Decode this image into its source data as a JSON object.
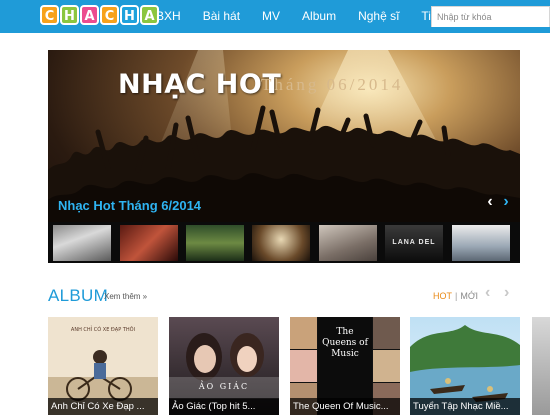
{
  "logo": {
    "letters": [
      "C",
      "H",
      "A",
      "C",
      "H",
      "A"
    ],
    "colors": [
      "#f7a21b",
      "#8cc63f",
      "#ec4d8f",
      "#f7a21b",
      "#1fa2dc",
      "#8cc63f"
    ]
  },
  "nav": {
    "items": [
      "BXH",
      "Bài hát",
      "MV",
      "Album",
      "Nghệ sĩ",
      "Tin tức"
    ]
  },
  "search": {
    "placeholder": "Nhập từ khóa",
    "value": ""
  },
  "hero": {
    "title": "NHẠC HOT",
    "subtitle": "Tháng 06/2014",
    "caption": "Nhạc Hot Tháng 6/2014",
    "prev_icon": "chevron-left-icon",
    "next_icon": "chevron-right-icon",
    "thumbnails": [
      {
        "name": "thumb-portrait-1"
      },
      {
        "name": "thumb-portrait-2"
      },
      {
        "name": "thumb-landscape"
      },
      {
        "name": "thumb-concert"
      },
      {
        "name": "thumb-portrait-3"
      },
      {
        "name": "thumb-lana-del-rey",
        "text": "LANA DEL REY"
      },
      {
        "name": "thumb-group"
      }
    ]
  },
  "album": {
    "title": "ALBUM",
    "more": "Xem thêm »",
    "tab_hot": "HOT",
    "separator": "|",
    "tab_new": "MỚI",
    "cards": [
      {
        "label": "Anh Chỉ Có Xe Đạp ...",
        "cover_text": "ANH CHỈ CÓ XE ĐẠP THÔI"
      },
      {
        "label": "Ảo Giác (Top hit 5...",
        "cover_text": "ẢO GIÁC"
      },
      {
        "label": "The Queen Of Music...",
        "cover_text": "The Queens of Music"
      },
      {
        "label": "Tuyển Tập Nhạc Miề..."
      }
    ]
  }
}
